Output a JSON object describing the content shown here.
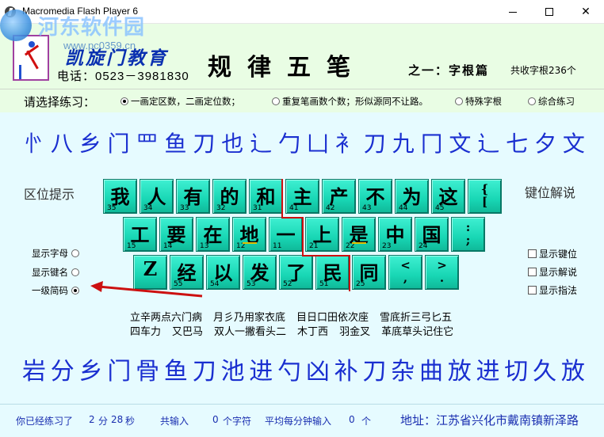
{
  "window": {
    "title": "Macromedia Flash Player 6"
  },
  "watermark": {
    "text": "河东软件园",
    "url": "www.pc0359.cn"
  },
  "header": {
    "school": "凯旋门教育",
    "phone": "电话：0523－3981830",
    "title": "规律五笔",
    "subtitle": "之一：字根篇",
    "total": "共收字根236个"
  },
  "practice": {
    "prompt": "请选择练习：",
    "options": [
      {
        "label": "一画定区数，二画定位数；",
        "selected": true
      },
      {
        "label": "重复笔画数个数；形似源同不让路。",
        "selected": false
      },
      {
        "label": "特殊字根",
        "selected": false
      },
      {
        "label": "综合练习",
        "selected": false
      }
    ]
  },
  "roots_top": [
    "㣺",
    "八",
    "乡",
    "门",
    "罒",
    "鱼",
    "刀",
    "也",
    "辶",
    "勹",
    "凵",
    "衤",
    "刀",
    "九",
    "冂",
    "文",
    "辶",
    "七",
    "夕",
    "文"
  ],
  "roots_bottom": [
    "岩",
    "分",
    "乡",
    "门",
    "骨",
    "鱼",
    "刀",
    "池",
    "进",
    "勺",
    "凶",
    "补",
    "刀",
    "杂",
    "曲",
    "放",
    "进",
    "切",
    "久",
    "放"
  ],
  "labels": {
    "zone_hint": "区位提示",
    "key_explain": "键位解说"
  },
  "keyboard": {
    "row1": [
      {
        "ch": "我",
        "num": "35"
      },
      {
        "ch": "人",
        "num": "34"
      },
      {
        "ch": "有",
        "num": "33"
      },
      {
        "ch": "的",
        "num": "32"
      },
      {
        "ch": "和",
        "num": "31"
      },
      {
        "ch": "主",
        "num": "41"
      },
      {
        "ch": "产",
        "num": "42"
      },
      {
        "ch": "不",
        "num": "43"
      },
      {
        "ch": "为",
        "num": "44"
      },
      {
        "ch": "这",
        "num": "45"
      },
      {
        "ch": "{\n[",
        "num": ""
      }
    ],
    "row2": [
      {
        "ch": "工",
        "num": "15"
      },
      {
        "ch": "要",
        "num": "14"
      },
      {
        "ch": "在",
        "num": "13"
      },
      {
        "ch": "地",
        "num": "12"
      },
      {
        "ch": "一",
        "num": "11"
      },
      {
        "ch": "上",
        "num": "21"
      },
      {
        "ch": "是",
        "num": "22"
      },
      {
        "ch": "中",
        "num": "23"
      },
      {
        "ch": "国",
        "num": "24"
      },
      {
        "ch": ":\n;",
        "num": ""
      }
    ],
    "row3": [
      {
        "ch": "Z",
        "num": ""
      },
      {
        "ch": "经",
        "num": "55"
      },
      {
        "ch": "以",
        "num": "54"
      },
      {
        "ch": "发",
        "num": "53"
      },
      {
        "ch": "了",
        "num": "52"
      },
      {
        "ch": "民",
        "num": "51"
      },
      {
        "ch": "同",
        "num": "25"
      },
      {
        "ch": "<\n,",
        "num": ""
      },
      {
        "ch": ">\n.",
        "num": ""
      }
    ]
  },
  "left_options": [
    {
      "label": "显示字母",
      "selected": false
    },
    {
      "label": "显示键名",
      "selected": false
    },
    {
      "label": "一级简码",
      "selected": true
    }
  ],
  "right_options": [
    {
      "label": "显示键位",
      "checked": false
    },
    {
      "label": "显示解说",
      "checked": false
    },
    {
      "label": "显示指法",
      "checked": false
    }
  ],
  "mnemonics": {
    "row1": [
      "立辛两点六门病",
      "月彡乃用家衣底",
      "目日口田依次座",
      "雪底折三弓匕五"
    ],
    "row2": [
      "四车力",
      "又巴马",
      "双人一撇看头二",
      "木丁西",
      "羽金叉",
      "革底草头记住它"
    ]
  },
  "footer": {
    "practiced_label": "你已经练习了",
    "minutes": "2",
    "min_unit": "分",
    "seconds": "28",
    "sec_unit": "秒",
    "total_label": "共输入",
    "chars": "0",
    "chars_unit": "个字符",
    "avg_label": "平均每分钟输入",
    "avg": "0",
    "avg_unit": "个",
    "address": "地址：江苏省兴化市戴南镇新泽路"
  },
  "colors": {
    "header_bg": "#e9fde4",
    "main_bg": "#e6fbff",
    "key": "#18d6b4",
    "root_text": "#1a2fd0",
    "arrow": "#cc1010"
  }
}
